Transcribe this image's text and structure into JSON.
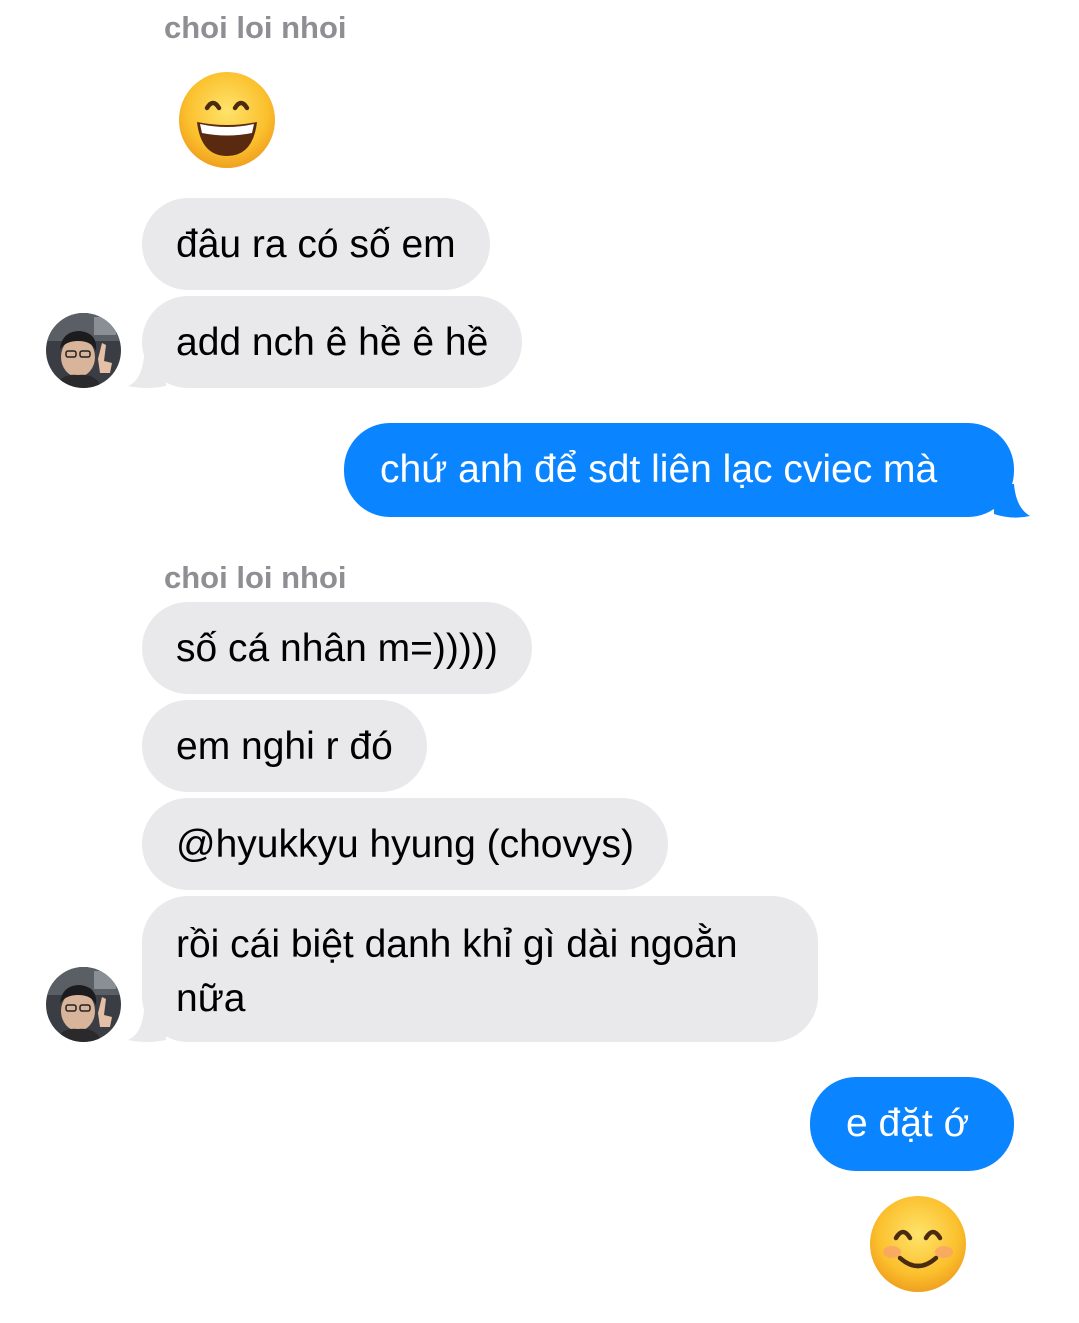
{
  "messages": {
    "group1": {
      "sender": "choi loi nhoi",
      "emoji_icon": "grinning-face-with-smiling-eyes",
      "bubble1": "đâu ra có số em",
      "bubble2": "add nch ê hề ê hề"
    },
    "outgoing1": "chứ anh để sdt liên lạc cviec mà",
    "group2": {
      "sender": "choi loi nhoi",
      "bubble1": "số cá nhân m=)))))",
      "bubble2": "em nghi r đó",
      "bubble3": "@hyukkyu hyung (chovys)",
      "bubble4": "rồi cái biệt danh khỉ gì dài ngoằn nữa"
    },
    "outgoing2": "e đặt ớ",
    "outgoing_emoji_icon": "smiling-face-with-smiling-eyes"
  },
  "colors": {
    "incoming_bubble": "#e9e9eb",
    "outgoing_bubble": "#0a84ff",
    "sender_name": "#8e8e93",
    "background": "#ffffff"
  }
}
